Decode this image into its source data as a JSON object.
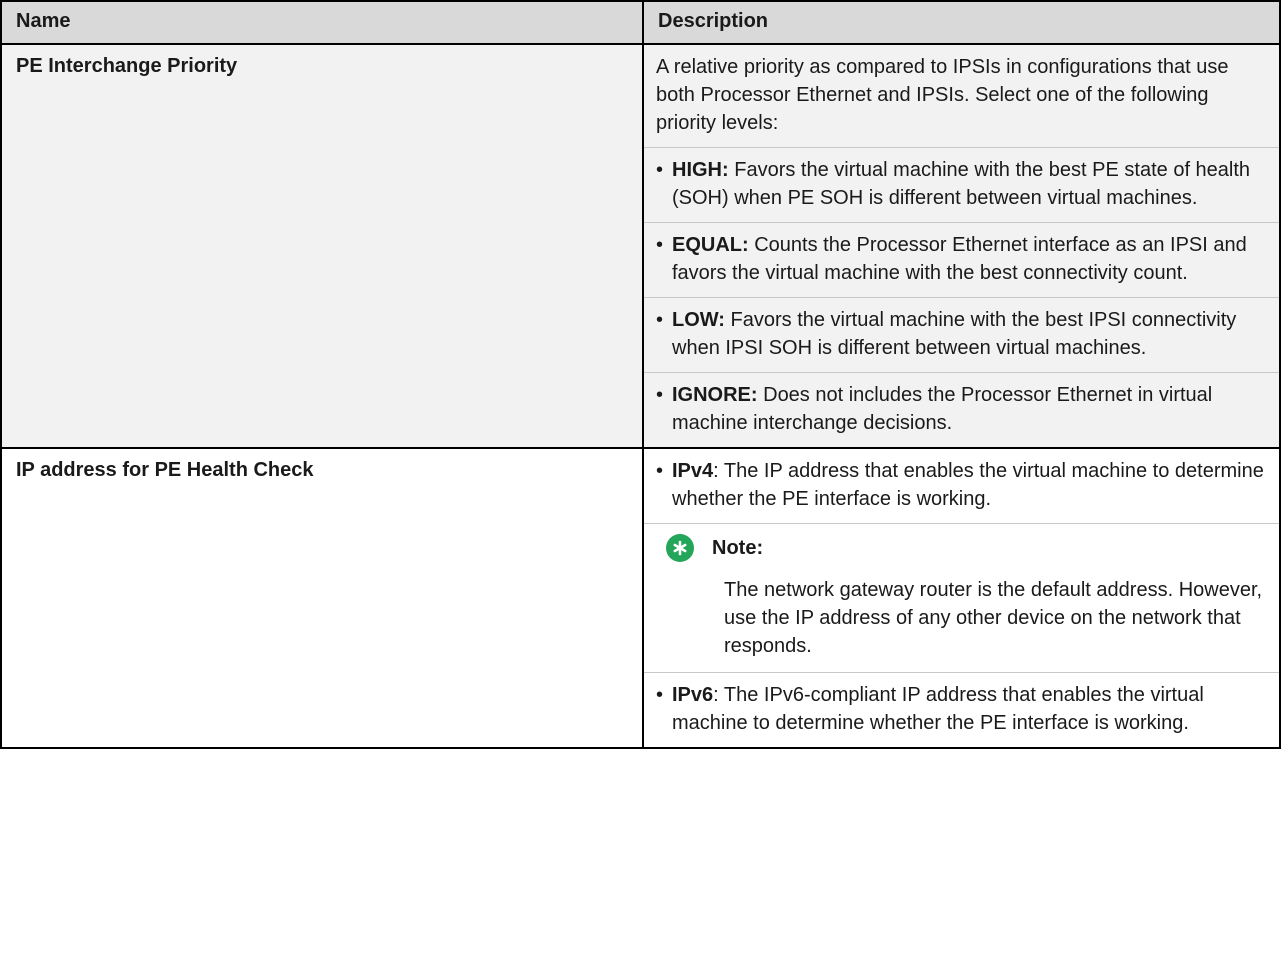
{
  "table": {
    "headers": {
      "name": "Name",
      "description": "Description"
    },
    "row1": {
      "name": "PE Interchange Priority",
      "intro": "A relative priority as compared to IPSIs in configurations that use both Processor Ethernet and IPSIs. Select one of the following priority levels:",
      "items": [
        {
          "term": "HIGH:",
          "text": " Favors the virtual machine with the best PE state of health (SOH) when PE SOH is different between virtual machines."
        },
        {
          "term": "EQUAL:",
          "text": " Counts the Processor Ethernet interface as an IPSI and favors the virtual machine with the best connectivity count."
        },
        {
          "term": "LOW:",
          "text": " Favors the virtual machine with the best IPSI connectivity when IPSI SOH is different between virtual machines."
        },
        {
          "term": "IGNORE:",
          "text": " Does not includes the Processor Ethernet in virtual machine interchange decisions."
        }
      ]
    },
    "row2": {
      "name": "IP address for PE Health Check",
      "ipv4": {
        "term": "IPv4",
        "text": ": The IP address that enables the virtual machine to determine whether the PE interface is working."
      },
      "note": {
        "label": "Note:",
        "text": "The network gateway router is the default address. However, use the IP address of any other device on the network that responds."
      },
      "ipv6": {
        "term": "IPv6",
        "text": ": The IPv6-compliant IP address that enables the virtual machine to determine whether the PE interface is working."
      }
    }
  },
  "icons": {
    "note": "note-asterisk-icon"
  },
  "colors": {
    "note_icon": "#23a55a",
    "header_bg": "#d9d9d9",
    "shaded_row_bg": "#f2f2f2"
  }
}
